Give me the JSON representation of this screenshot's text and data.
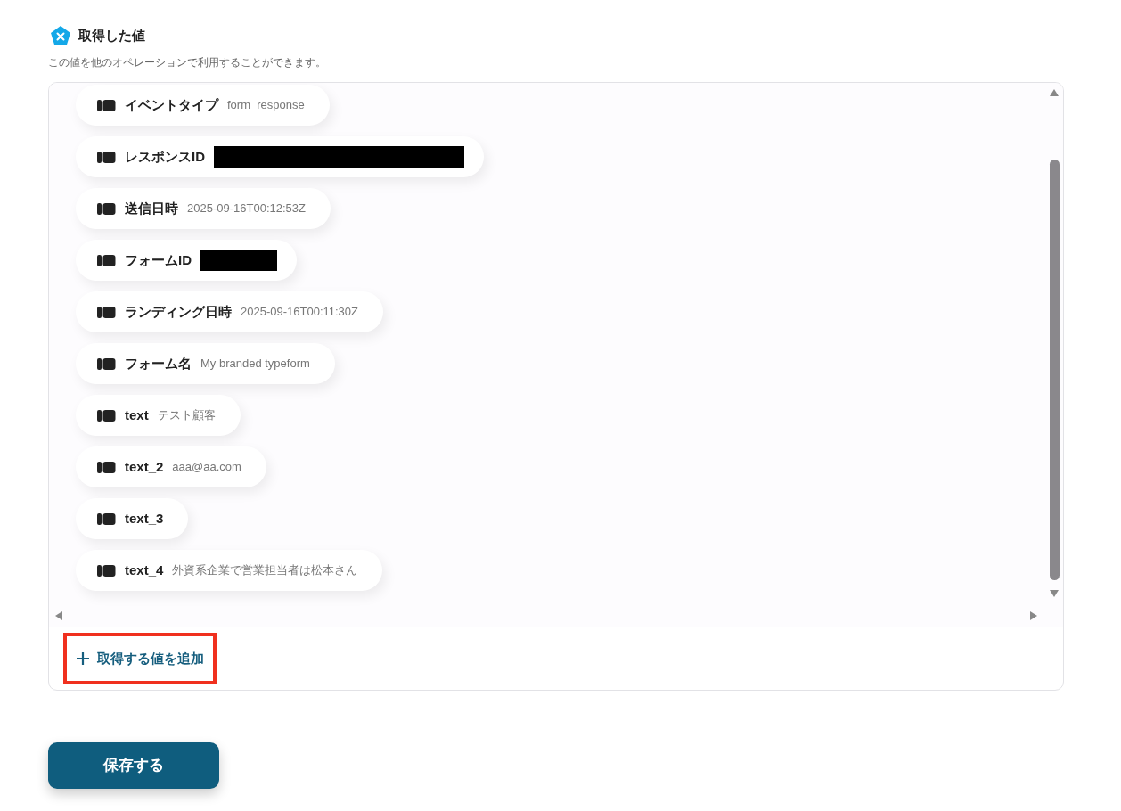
{
  "section": {
    "title": "取得した値",
    "description": "この値を他のオペレーションで利用することができます。"
  },
  "values": [
    {
      "label": "イベントタイプ",
      "value": "form_response"
    },
    {
      "label": "レスポンスID",
      "redacted": true
    },
    {
      "label": "送信日時",
      "value": "2025-09-16T00:12:53Z"
    },
    {
      "label": "フォームID",
      "redacted": true
    },
    {
      "label": "ランディング日時",
      "value": "2025-09-16T00:11:30Z"
    },
    {
      "label": "フォーム名",
      "value": "My branded typeform"
    },
    {
      "label": "text",
      "value": "テスト顧客"
    },
    {
      "label": "text_2",
      "value": "aaa@aa.com"
    },
    {
      "label": "text_3"
    },
    {
      "label": "text_4",
      "value": "外資系企業で営業担当者は松本さん"
    }
  ],
  "add_button": {
    "label": "取得する値を追加",
    "highlighted": true
  },
  "save_button": {
    "label": "保存する"
  }
}
